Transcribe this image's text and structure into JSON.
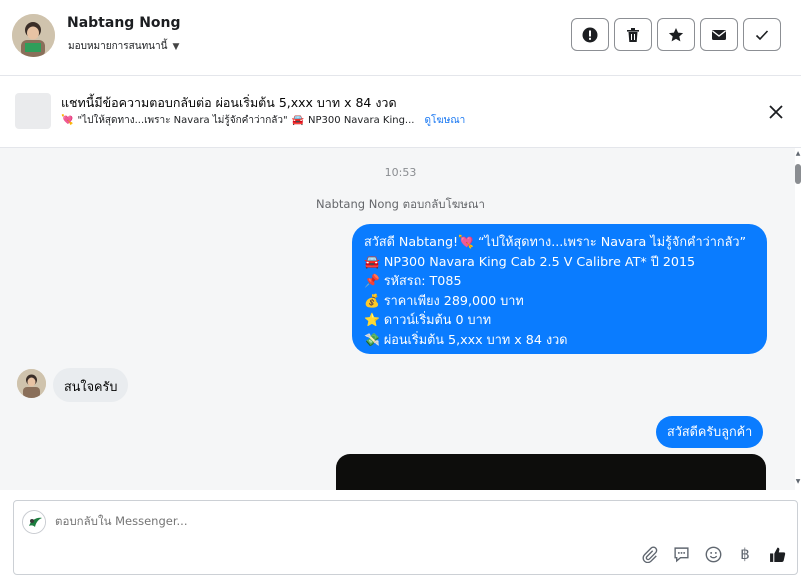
{
  "header": {
    "contact_name": "Nabtang Nong",
    "assign_label": "มอบหมายการสนทนานี้",
    "actions": [
      {
        "icon": "alert-icon",
        "label": "Mark as spam"
      },
      {
        "icon": "trash-icon",
        "label": "Delete"
      },
      {
        "icon": "star-icon",
        "label": "Star"
      },
      {
        "icon": "envelope-icon",
        "label": "Mark as unread"
      },
      {
        "icon": "check-icon",
        "label": "Done"
      }
    ]
  },
  "banner": {
    "title": "แชทนี้มีข้อความตอบกลับต่อ ผ่อนเริ่มต้น 5,xxx บาท x 84 งวด",
    "subtitle_emoji": "💘",
    "subtitle_part1": "\"ไปให้สุดทาง...เพราะ Navara ไม่รู้จักคำว่ากลัว\"",
    "subtitle_emoji2": "🚘",
    "subtitle_part2": "NP300 Navara King...",
    "view_ad_link": "ดูโฆษณา"
  },
  "conversation": {
    "timestamp": "10:53",
    "ad_reply_note": "Nabtang Nong ตอบกลับโฆษณา",
    "outgoing_main": {
      "lines": [
        "สวัสดี Nabtang!💘 “ไปให้สุดทาง...เพราะ Navara ไม่รู้จักคำว่ากลัว”",
        "🚘 NP300 Navara King Cab 2.5 V Calibre AT* ปี 2015",
        "📌 รหัสรถ: T085",
        "💰 ราคาเพียง 289,000 บาท",
        "⭐ ดาวน์เริ่มต้น 0 บาท",
        "💸 ผ่อนเริ่มต้น 5,xxx บาท x 84 งวด"
      ]
    },
    "incoming": "สนใจครับ",
    "outgoing_greeting": "สวัสดีครับลูกค้า"
  },
  "composer": {
    "placeholder": "ตอบกลับใน Messenger...",
    "tools": [
      "paperclip-icon",
      "saved-reply-icon",
      "emoji-icon",
      "baht-icon",
      "thumbs-up-icon"
    ],
    "baht_symbol": "฿"
  },
  "colors": {
    "accent": "#0a7cff",
    "incoming_bubble": "#e9ecef",
    "conversation_bg": "#f5f6f7"
  }
}
